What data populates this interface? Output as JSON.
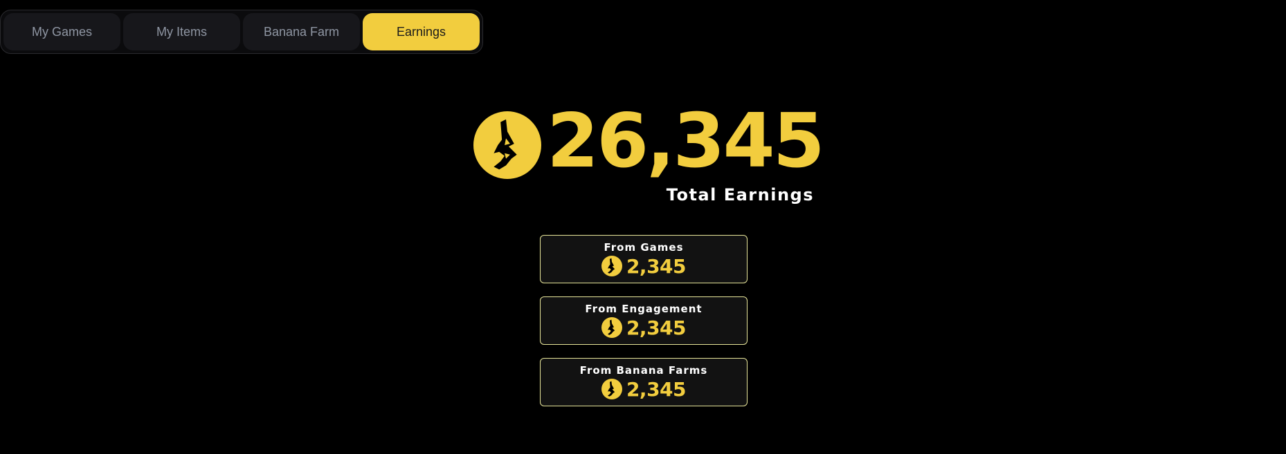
{
  "tabs": [
    {
      "label": "My Games",
      "active": false
    },
    {
      "label": "My Items",
      "active": false
    },
    {
      "label": "Banana Farm",
      "active": false
    },
    {
      "label": "Earnings",
      "active": true
    }
  ],
  "earnings": {
    "total": "26,345",
    "total_label": "Total Earnings",
    "currency_icon": "banana-coin-icon",
    "breakdown": [
      {
        "title": "From Games",
        "amount": "2,345"
      },
      {
        "title": "From Engagement",
        "amount": "2,345"
      },
      {
        "title": "From Banana Farms",
        "amount": "2,345"
      }
    ]
  },
  "colors": {
    "background": "#000000",
    "accent": "#f2cd3e",
    "tab_inactive_bg": "#17171b",
    "tab_inactive_text": "#8f96a3",
    "card_border": "#e8e69a",
    "card_bg": "#121212"
  }
}
